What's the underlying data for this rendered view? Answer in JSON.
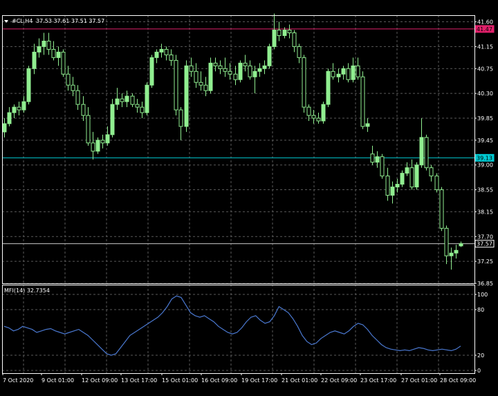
{
  "header": {
    "symbol": "#CL,H4",
    "ohlc": "37.53 37.61 37.51 37.57"
  },
  "indicator": {
    "label": "MFI(14) 32.7354"
  },
  "colors": {
    "background": "#000000",
    "frame": "#ffffff",
    "grid": "#5a5a5a",
    "bull_candle": "#90ee90",
    "bear_candle": "#000000",
    "candle_outline": "#90ee90",
    "mfi_line": "#4a78d0",
    "level_high": "#e0206a",
    "level_mid": "#00c8d0",
    "level_current": "#c8c8c8"
  },
  "chart_data": [
    {
      "type": "candlestick",
      "title": "#CL,H4",
      "x_tick_labels": [
        "7 Oct 2020",
        "9 Oct 01:00",
        "12 Oct 09:00",
        "13 Oct 17:00",
        "15 Oct 01:00",
        "16 Oct 09:00",
        "19 Oct 17:00",
        "21 Oct 01:00",
        "22 Oct 09:00",
        "23 Oct 17:00",
        "27 Oct 01:00",
        "28 Oct 09:00"
      ],
      "y_tick_labels": [
        "41.60",
        "41.15",
        "40.75",
        "40.30",
        "39.85",
        "39.45",
        "39.00",
        "38.55",
        "38.15",
        "37.70",
        "37.25",
        "36.85"
      ],
      "ylim": [
        36.85,
        41.72
      ],
      "levels": [
        {
          "label": "41.47",
          "value": 41.47,
          "color": "#e0206a"
        },
        {
          "label": "39.13",
          "value": 39.13,
          "color": "#00c8d0"
        },
        {
          "label": "37.57",
          "value": 37.57,
          "color": "#c8c8c8"
        }
      ],
      "candles": [
        [
          39.6,
          39.85,
          39.5,
          39.75
        ],
        [
          39.75,
          40.05,
          39.7,
          39.95
        ],
        [
          39.95,
          40.1,
          39.85,
          40.05
        ],
        [
          40.05,
          40.15,
          39.9,
          40.0
        ],
        [
          40.0,
          40.25,
          39.95,
          40.15
        ],
        [
          40.15,
          40.8,
          40.1,
          40.75
        ],
        [
          40.75,
          41.2,
          40.65,
          41.05
        ],
        [
          41.05,
          41.3,
          40.95,
          41.15
        ],
        [
          41.15,
          41.4,
          41.0,
          41.25
        ],
        [
          41.25,
          41.4,
          41.0,
          41.1
        ],
        [
          41.1,
          41.25,
          40.9,
          40.95
        ],
        [
          40.95,
          41.15,
          40.8,
          41.05
        ],
        [
          41.05,
          41.1,
          40.6,
          40.65
        ],
        [
          40.65,
          40.8,
          40.35,
          40.45
        ],
        [
          40.45,
          40.6,
          40.25,
          40.35
        ],
        [
          40.35,
          40.45,
          40.0,
          40.1
        ],
        [
          40.1,
          40.25,
          39.8,
          39.9
        ],
        [
          39.9,
          40.05,
          39.35,
          39.4
        ],
        [
          39.4,
          39.6,
          39.1,
          39.25
        ],
        [
          39.25,
          39.5,
          39.2,
          39.45
        ],
        [
          39.45,
          39.55,
          39.3,
          39.4
        ],
        [
          39.4,
          39.7,
          39.35,
          39.55
        ],
        [
          39.55,
          40.2,
          39.5,
          40.1
        ],
        [
          40.1,
          40.4,
          40.0,
          40.2
        ],
        [
          40.2,
          40.3,
          40.05,
          40.15
        ],
        [
          40.15,
          40.35,
          40.05,
          40.25
        ],
        [
          40.25,
          40.3,
          40.05,
          40.1
        ],
        [
          40.1,
          40.2,
          39.95,
          40.05
        ],
        [
          40.05,
          40.15,
          39.85,
          39.95
        ],
        [
          39.95,
          40.5,
          39.9,
          40.45
        ],
        [
          40.45,
          41.0,
          40.4,
          40.95
        ],
        [
          40.95,
          41.1,
          40.85,
          41.05
        ],
        [
          41.05,
          41.2,
          40.95,
          41.1
        ],
        [
          41.1,
          41.15,
          40.9,
          41.0
        ],
        [
          41.0,
          41.1,
          40.8,
          40.9
        ],
        [
          40.9,
          41.0,
          39.9,
          40.0
        ],
        [
          40.0,
          40.05,
          39.45,
          39.7
        ],
        [
          39.7,
          40.9,
          39.6,
          40.8
        ],
        [
          40.8,
          40.95,
          40.6,
          40.7
        ],
        [
          40.7,
          40.85,
          40.4,
          40.5
        ],
        [
          40.5,
          40.7,
          40.35,
          40.45
        ],
        [
          40.45,
          40.6,
          40.25,
          40.35
        ],
        [
          40.35,
          40.95,
          40.3,
          40.85
        ],
        [
          40.85,
          40.95,
          40.7,
          40.8
        ],
        [
          40.8,
          40.9,
          40.65,
          40.75
        ],
        [
          40.75,
          40.95,
          40.6,
          40.7
        ],
        [
          40.7,
          40.85,
          40.55,
          40.65
        ],
        [
          40.65,
          40.8,
          40.45,
          40.55
        ],
        [
          40.55,
          40.9,
          40.5,
          40.85
        ],
        [
          40.85,
          41.0,
          40.7,
          40.8
        ],
        [
          40.8,
          40.9,
          40.55,
          40.6
        ],
        [
          40.6,
          40.8,
          40.3,
          40.7
        ],
        [
          40.7,
          40.85,
          40.6,
          40.75
        ],
        [
          40.75,
          40.9,
          40.65,
          40.8
        ],
        [
          40.8,
          41.2,
          40.75,
          41.15
        ],
        [
          41.15,
          41.75,
          41.1,
          41.45
        ],
        [
          41.45,
          41.6,
          41.25,
          41.35
        ],
        [
          41.35,
          41.5,
          41.3,
          41.45
        ],
        [
          41.45,
          41.55,
          41.3,
          41.4
        ],
        [
          41.4,
          41.45,
          41.05,
          41.15
        ],
        [
          41.15,
          41.2,
          40.85,
          40.95
        ],
        [
          40.95,
          41.0,
          39.95,
          40.05
        ],
        [
          40.05,
          40.1,
          39.8,
          39.9
        ],
        [
          39.9,
          40.0,
          39.75,
          39.85
        ],
        [
          39.85,
          39.95,
          39.75,
          39.8
        ],
        [
          39.8,
          40.15,
          39.75,
          40.1
        ],
        [
          40.1,
          40.75,
          40.05,
          40.7
        ],
        [
          40.7,
          40.85,
          40.55,
          40.6
        ],
        [
          40.6,
          40.75,
          40.5,
          40.65
        ],
        [
          40.65,
          40.8,
          40.55,
          40.75
        ],
        [
          40.75,
          40.85,
          40.5,
          40.55
        ],
        [
          40.55,
          40.95,
          40.5,
          40.8
        ],
        [
          40.8,
          40.95,
          40.55,
          40.6
        ],
        [
          40.6,
          40.7,
          39.65,
          39.7
        ],
        [
          39.7,
          39.85,
          39.6,
          39.75
        ],
        [
          39.2,
          39.35,
          39.0,
          39.05
        ],
        [
          39.05,
          39.25,
          38.95,
          39.15
        ],
        [
          39.15,
          39.2,
          38.75,
          38.8
        ],
        [
          38.8,
          38.95,
          38.35,
          38.45
        ],
        [
          38.45,
          38.7,
          38.3,
          38.6
        ],
        [
          38.6,
          38.75,
          38.5,
          38.65
        ],
        [
          38.65,
          38.9,
          38.6,
          38.85
        ],
        [
          38.85,
          39.05,
          38.8,
          38.95
        ],
        [
          38.95,
          39.1,
          38.55,
          38.6
        ],
        [
          38.6,
          39.05,
          38.55,
          39.0
        ],
        [
          39.0,
          39.85,
          38.95,
          39.5
        ],
        [
          39.5,
          39.55,
          38.9,
          38.95
        ],
        [
          38.95,
          39.0,
          38.7,
          38.8
        ],
        [
          38.8,
          38.85,
          38.5,
          38.55
        ],
        [
          38.55,
          38.6,
          37.8,
          37.85
        ],
        [
          37.85,
          37.9,
          37.2,
          37.35
        ],
        [
          37.35,
          37.5,
          37.1,
          37.4
        ],
        [
          37.4,
          37.55,
          37.3,
          37.45
        ],
        [
          37.53,
          37.61,
          37.51,
          37.57
        ]
      ]
    },
    {
      "type": "line",
      "title": "MFI(14) 32.7354",
      "y_tick_labels": [
        "100",
        "80",
        "20",
        "0"
      ],
      "ylim": [
        0,
        100
      ],
      "values": [
        58,
        56,
        52,
        54,
        58,
        56,
        54,
        50,
        52,
        54,
        55,
        52,
        50,
        48,
        50,
        52,
        54,
        50,
        46,
        40,
        34,
        28,
        22,
        20,
        22,
        30,
        38,
        46,
        50,
        54,
        58,
        62,
        66,
        70,
        76,
        84,
        94,
        98,
        96,
        86,
        76,
        72,
        70,
        72,
        68,
        64,
        58,
        54,
        50,
        48,
        50,
        56,
        64,
        70,
        72,
        66,
        62,
        64,
        72,
        84,
        80,
        76,
        68,
        58,
        46,
        38,
        34,
        36,
        42,
        46,
        50,
        52,
        50,
        48,
        52,
        58,
        62,
        60,
        54,
        46,
        40,
        34,
        30,
        28,
        27,
        26,
        27,
        26,
        28,
        30,
        29,
        27,
        26,
        27,
        28,
        27,
        26,
        28,
        32
      ]
    }
  ]
}
